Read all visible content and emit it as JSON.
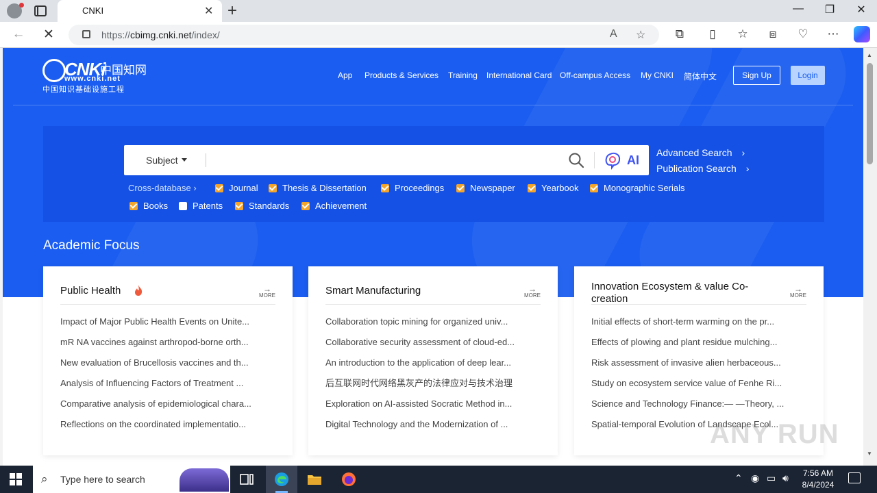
{
  "browser": {
    "tab_title": "CNKI",
    "tab_close": "✕",
    "new_tab": "+",
    "url_base": "https://",
    "url_domain": "cbimg.cnki.net",
    "url_path": "/index/",
    "window_controls": {
      "minimize": "—",
      "maximize": "❐",
      "close": "✕"
    }
  },
  "site": {
    "logo": {
      "brand": "CNKi",
      "chinese": "中国知网",
      "url": "www.cnki.net",
      "subtitle": "中国知识基础设施工程"
    },
    "nav": [
      "App",
      "Products & Services",
      "Training",
      "International Card",
      "Off-campus Access",
      "My CNKI",
      "简体中文"
    ],
    "signup": "Sign Up",
    "login": "Login"
  },
  "search": {
    "field_type": "Subject",
    "ai_label": "AI",
    "advanced": "Advanced Search",
    "publication": "Publication Search",
    "chevron": "›",
    "cross_db": "Cross-database ›",
    "databases": [
      {
        "label": "Journal",
        "checked": true
      },
      {
        "label": "Thesis & Dissertation",
        "checked": true
      },
      {
        "label": "Proceedings",
        "checked": true
      },
      {
        "label": "Newspaper",
        "checked": true
      },
      {
        "label": "Yearbook",
        "checked": true
      },
      {
        "label": "Monographic Serials",
        "checked": true
      },
      {
        "label": "Books",
        "checked": true
      },
      {
        "label": "Patents",
        "checked": false
      },
      {
        "label": "Standards",
        "checked": true
      },
      {
        "label": "Achievement",
        "checked": true
      }
    ]
  },
  "focus": {
    "heading": "Academic Focus",
    "more": "MORE",
    "cards": [
      {
        "title": "Public Health",
        "items": [
          "Impact of Major Public Health Events on Unite...",
          "mR NA vaccines against arthropod-borne orth...",
          "New evaluation of Brucellosis vaccines and th...",
          "Analysis of Influencing Factors of Treatment ...",
          "Comparative analysis of epidemiological chara...",
          "Reflections on the coordinated implementatio..."
        ]
      },
      {
        "title": "Smart Manufacturing",
        "items": [
          "Collaboration topic mining for organized univ...",
          "Collaborative security assessment of cloud-ed...",
          "An introduction to the application of deep lear...",
          "后互联网时代网络黑灰产的法律应对与技术治理",
          "Exploration on AI-assisted Socratic Method in...",
          "Digital Technology and the Modernization of ..."
        ]
      },
      {
        "title": "Innovation Ecosystem & value Co-creation",
        "items": [
          "Initial effects of short-term warming on the pr...",
          "Effects of plowing and plant residue mulching...",
          "Risk assessment of invasive alien herbaceous...",
          "Study on ecosystem service value of Fenhe Ri...",
          "Science and Technology Finance:— —Theory, ...",
          "Spatial-temporal Evolution of Landscape Ecol..."
        ]
      }
    ]
  },
  "watermark": "ANY RUN",
  "taskbar": {
    "search_placeholder": "Type here to search",
    "time": "7:56 AM",
    "date": "8/4/2024"
  },
  "colors": {
    "brand_blue": "#1a5df0",
    "panel_blue": "#1451e4",
    "checkbox": "#f4a52b"
  }
}
